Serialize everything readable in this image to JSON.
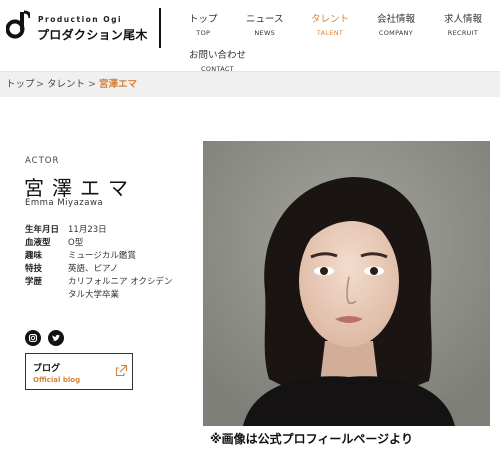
{
  "brand": {
    "name_en": "Production Ogi",
    "name_ja": "プロダクション尾木"
  },
  "nav": {
    "items": [
      {
        "ja": "トップ",
        "en": "TOP"
      },
      {
        "ja": "ニュース",
        "en": "NEWS"
      },
      {
        "ja": "タレント",
        "en": "TALENT"
      },
      {
        "ja": "会社情報",
        "en": "COMPANY"
      },
      {
        "ja": "求人情報",
        "en": "RECRUIT"
      },
      {
        "ja": "お問い合わせ",
        "en": "CONTACT"
      }
    ],
    "active": "TALENT"
  },
  "breadcrumb": {
    "items": [
      "トップ",
      "タレント",
      "宮澤エマ"
    ],
    "separator": ">"
  },
  "profile": {
    "category": "ACTOR",
    "name_ja": "宮澤エマ",
    "name_en": "Emma Miyazawa",
    "details": [
      {
        "label": "生年月日",
        "value": "11月23日"
      },
      {
        "label": "血液型",
        "value": "O型"
      },
      {
        "label": "趣味",
        "value": "ミュージカル鑑賞"
      },
      {
        "label": "特技",
        "value": "英語、ピアノ"
      },
      {
        "label": "学歴",
        "value": "カリフォルニア オクシデン"
      },
      {
        "label": "",
        "value": "タル大学卒業"
      }
    ]
  },
  "social": [
    {
      "icon": "instagram-icon"
    },
    {
      "icon": "twitter-icon"
    }
  ],
  "blog": {
    "title": "ブログ",
    "subtitle": "Official blog"
  },
  "caption": "※画像は公式プロフィールページより",
  "colors": {
    "accent": "#d4843a",
    "crumb_bg": "#f0f0f0",
    "photo_bg": "#8f9089"
  }
}
